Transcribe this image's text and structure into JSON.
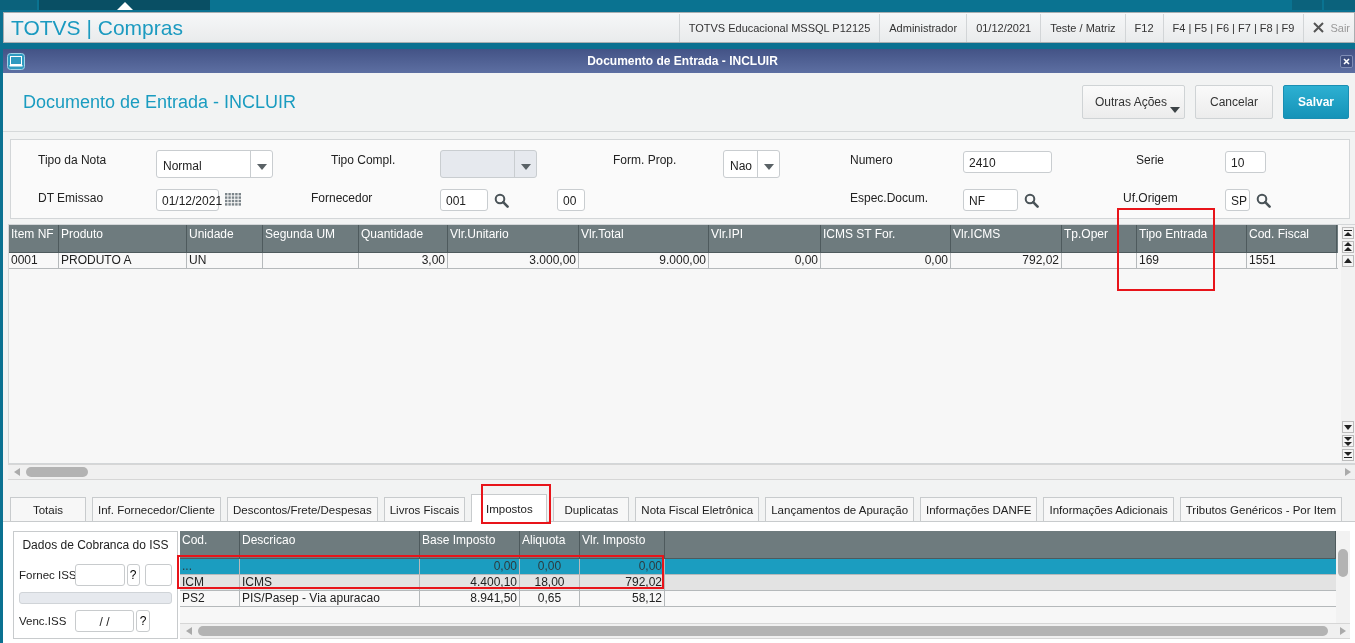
{
  "top_bar": {
    "tabs": [
      {
        "selected": false
      },
      {
        "selected": true
      },
      {
        "selected": false
      },
      {
        "selected": false
      }
    ]
  },
  "app_header": {
    "title": "TOTVS | Compras",
    "info_items": [
      "TOTVS Educacional MSSQL P12125",
      "Administrador",
      "01/12/2021",
      "Teste / Matriz",
      "F12",
      "F4 | F5 | F6 | F7 | F8 | F9"
    ],
    "exit_label": "Sair"
  },
  "window": {
    "title": "Documento de Entrada - INCLUIR"
  },
  "page": {
    "heading": "Documento de Entrada - INCLUIR",
    "buttons": [
      {
        "label": "Outras Ações",
        "kind": "menu"
      },
      {
        "label": "Cancelar",
        "kind": "default"
      },
      {
        "label": "Salvar",
        "kind": "primary"
      }
    ]
  },
  "form": {
    "fields": [
      {
        "label": "Tipo da Nota",
        "kind": "select",
        "value": "Normal",
        "disabled": false
      },
      {
        "label": "Tipo Compl.",
        "kind": "select",
        "disabled": true
      },
      {
        "label": "Form. Prop.",
        "kind": "select",
        "value": "Nao",
        "disabled": false
      },
      {
        "label": "Numero",
        "kind": "input",
        "value": "2410",
        "disabled": false
      },
      {
        "label": "Serie",
        "kind": "input",
        "value": "10",
        "disabled": false
      },
      {
        "label": "DT Emissao",
        "kind": "date",
        "value": "01/12/2021",
        "disabled": false
      },
      {
        "label": "Fornecedor",
        "kind": "lookup",
        "value": "001",
        "second_value": "00",
        "disabled": false
      },
      {
        "label": "Espec.Docum.",
        "kind": "lookup",
        "value": "NF",
        "disabled": false
      },
      {
        "label": "Uf.Origem",
        "kind": "lookup",
        "value": "SP",
        "disabled": false
      }
    ]
  },
  "items_grid": {
    "columns": [
      {
        "label": "Item NF",
        "kind": "text",
        "highlighted": false
      },
      {
        "label": "Produto",
        "kind": "text",
        "highlighted": false
      },
      {
        "label": "Unidade",
        "kind": "text",
        "highlighted": false
      },
      {
        "label": "Segunda UM",
        "kind": "text",
        "highlighted": false
      },
      {
        "label": "Quantidade",
        "kind": "number",
        "highlighted": false
      },
      {
        "label": "Vlr.Unitario",
        "kind": "number",
        "highlighted": false
      },
      {
        "label": "Vlr.Total",
        "kind": "number",
        "highlighted": false
      },
      {
        "label": "Vlr.IPI",
        "kind": "number",
        "highlighted": false
      },
      {
        "label": "ICMS ST For.",
        "kind": "number",
        "highlighted": false
      },
      {
        "label": "Vlr.ICMS",
        "kind": "number",
        "highlighted": false
      },
      {
        "label": "Tp.Oper",
        "kind": "text",
        "highlighted": false
      },
      {
        "label": "Tipo Entrada",
        "kind": "text",
        "highlighted": true
      },
      {
        "label": "Cod. Fiscal",
        "kind": "text",
        "highlighted": false
      }
    ],
    "rows": [
      {
        "selected": false,
        "highlighted": false,
        "cells": [
          {
            "text": "0001"
          },
          {
            "text": "PRODUTO A"
          },
          {
            "text": "UN"
          },
          {},
          {
            "text": "3,00"
          },
          {
            "text": "3.000,00"
          },
          {
            "text": "9.000,00"
          },
          {
            "text": "0,00"
          },
          {
            "text": "0,00"
          },
          {
            "text": "792,02"
          },
          {},
          {
            "text": "169"
          },
          {
            "text": "1551"
          }
        ]
      }
    ]
  },
  "tabs": [
    {
      "label": "Totais",
      "selected": false,
      "highlighted": false
    },
    {
      "label": "Inf. Fornecedor/Cliente",
      "selected": false,
      "highlighted": false
    },
    {
      "label": "Descontos/Frete/Despesas",
      "selected": false,
      "highlighted": false
    },
    {
      "label": "Livros Fiscais",
      "selected": false,
      "highlighted": false
    },
    {
      "label": "Impostos",
      "selected": true,
      "highlighted": true
    },
    {
      "label": "Duplicatas",
      "selected": false,
      "highlighted": false
    },
    {
      "label": "Nota Fiscal Eletrônica",
      "selected": false,
      "highlighted": false
    },
    {
      "label": "Lançamentos de Apuração",
      "selected": false,
      "highlighted": false
    },
    {
      "label": "Informações DANFE",
      "selected": false,
      "highlighted": false
    },
    {
      "label": "Informações Adicionais",
      "selected": false,
      "highlighted": false
    },
    {
      "label": "Tributos Genéricos - Por Item",
      "selected": false,
      "highlighted": false
    }
  ],
  "iss_panel": {
    "title": "Dados de Cobranca do ISS",
    "fields": [
      {
        "label": "Fornec ISS",
        "help": "?"
      },
      {
        "label": "Venc.ISS",
        "value": "/ /",
        "help": "?"
      }
    ]
  },
  "tax_grid": {
    "columns": [
      {
        "label": "Cod.",
        "kind": "text",
        "highlighted": false
      },
      {
        "label": "Descricao",
        "kind": "text",
        "highlighted": false
      },
      {
        "label": "Base Imposto",
        "kind": "number",
        "highlighted": false
      },
      {
        "label": "Aliquota",
        "kind": "center",
        "highlighted": false
      },
      {
        "label": "Vlr. Imposto",
        "kind": "number",
        "highlighted": false
      }
    ],
    "rows": [
      {
        "selected": true,
        "highlighted": true,
        "cells": [
          {
            "text": "..."
          },
          {},
          {
            "text": "0,00"
          },
          {
            "text": "0,00"
          },
          {
            "text": "0,00"
          }
        ]
      },
      {
        "selected": false,
        "highlighted": true,
        "cells": [
          {
            "text": "ICM"
          },
          {
            "text": "ICMS"
          },
          {
            "text": "4.400,10"
          },
          {
            "text": "18,00"
          },
          {
            "text": "792,02"
          }
        ]
      },
      {
        "selected": false,
        "highlighted": false,
        "cells": [
          {
            "text": "PS2"
          },
          {
            "text": "PIS/Pasep - Via apuracao"
          },
          {
            "text": "8.941,50"
          },
          {
            "text": "0,65"
          },
          {
            "text": "58,12"
          }
        ]
      }
    ]
  }
}
